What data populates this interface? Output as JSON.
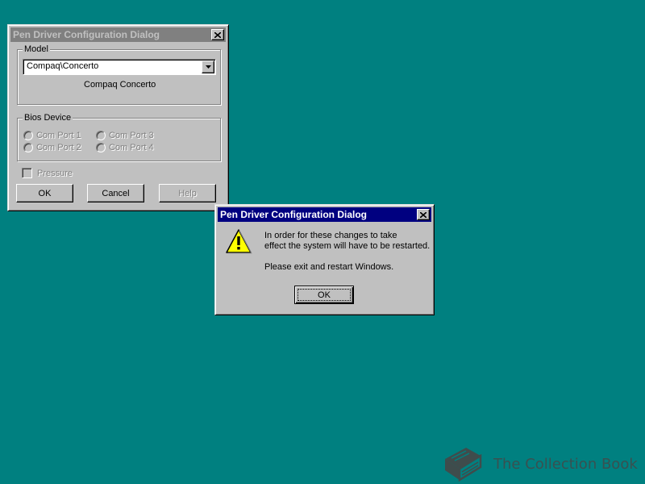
{
  "config_dialog": {
    "title": "Pen Driver Configuration Dialog",
    "model_group": {
      "label": "Model",
      "selected": "Compaq\\Concerto",
      "description": "Compaq Concerto"
    },
    "bios_group": {
      "label": "Bios Device",
      "ports": [
        "Com Port 1",
        "Com Port 2",
        "Com Port 3",
        "Com Port 4"
      ]
    },
    "pressure_label": "Pressure",
    "buttons": {
      "ok": "OK",
      "cancel": "Cancel",
      "help": "Help"
    }
  },
  "alert_dialog": {
    "title": "Pen Driver Configuration Dialog",
    "message_line1": "In order for these changes to take",
    "message_line2": "effect the system will have to be restarted.",
    "message_line3": "Please exit and restart Windows.",
    "ok": "OK"
  },
  "watermark": {
    "text": "The Collection Book"
  },
  "colors": {
    "desktop": "#008080",
    "active_title": "#000080",
    "inactive_title": "#808080",
    "face": "#c0c0c0"
  },
  "icons": {
    "warning": "warning-icon",
    "close": "close-icon",
    "dropdown": "chevron-down-icon",
    "book": "book-icon"
  }
}
